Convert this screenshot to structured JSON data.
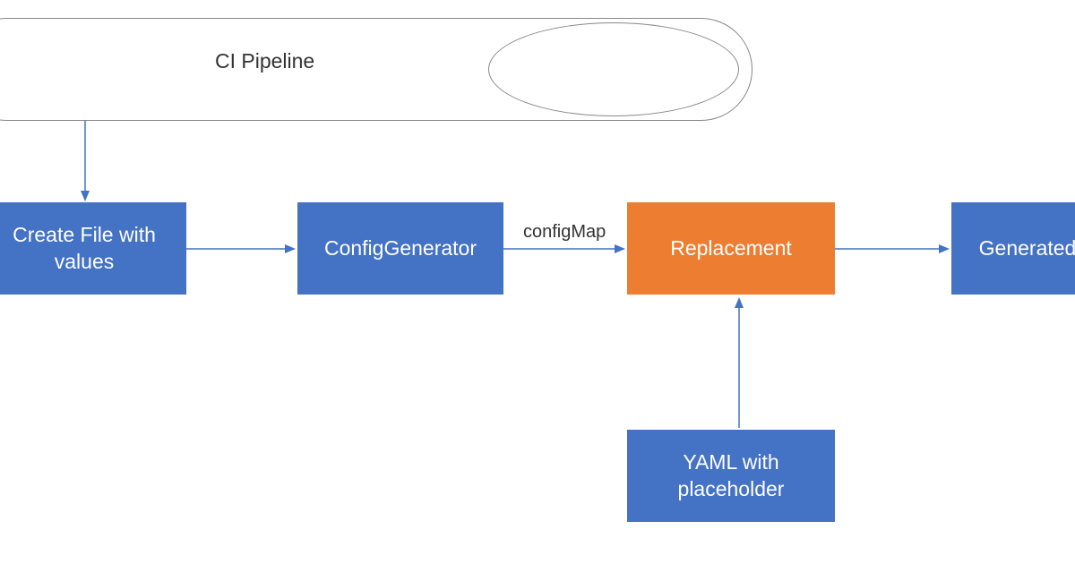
{
  "title": "CI Pipeline",
  "nodes": {
    "createFile": "Create File with values",
    "configGenerator": "ConfigGenerator",
    "replacement": "Replacement",
    "generated": "Generated",
    "yamlPlaceholder": "YAML with placeholder"
  },
  "edgeLabels": {
    "configMap": "configMap"
  },
  "colors": {
    "blue": "#4472C4",
    "orange": "#ED7D31"
  }
}
